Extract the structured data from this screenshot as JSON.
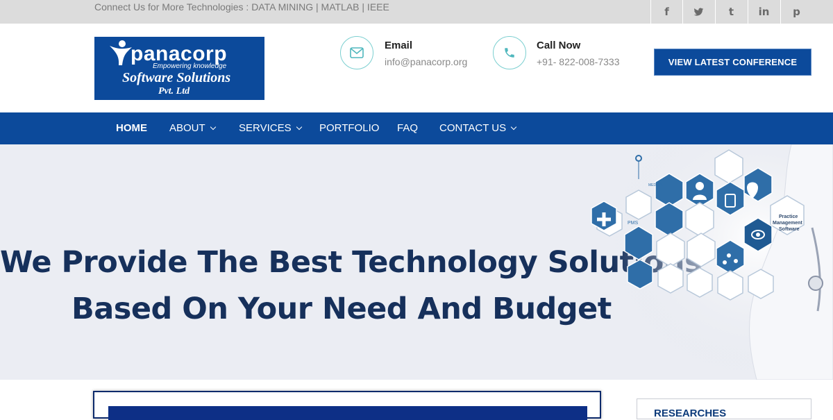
{
  "topbar": {
    "tagline": "Connect Us for More Technologies : DATA MINING | MATLAB | IEEE",
    "social": [
      {
        "icon": "facebook-icon",
        "glyph": "f"
      },
      {
        "icon": "twitter-icon",
        "glyph": "t"
      },
      {
        "icon": "tumblr-icon",
        "glyph": "t"
      },
      {
        "icon": "linkedin-icon",
        "glyph": "in"
      },
      {
        "icon": "pinterest-icon",
        "glyph": "p"
      }
    ]
  },
  "logo": {
    "brand": "panacorp",
    "slogan": "Empowering knowledge",
    "line2": "Software Solutions",
    "line3": "Pvt. Ltd"
  },
  "contact": {
    "email_title": "Email",
    "email_value": "info@panacorp.org",
    "phone_title": "Call Now",
    "phone_value": "+91- 822-008-7333"
  },
  "header": {
    "conference_button": "VIEW LATEST CONFERENCE"
  },
  "nav": {
    "home": "HOME",
    "about": "ABOUT",
    "services": "SERVICES",
    "portfolio": "PORTFOLIO",
    "faq": "FAQ",
    "contact": "CONTACT US"
  },
  "hero": {
    "line1": "We Provide The Best Technology Solutions",
    "line2": "Based On Your Need And Budget",
    "art_labels": {
      "pms": "PMS",
      "practice1": "Practice",
      "practice2": "Management",
      "practice3": "Software",
      "medical": "MEDICAL"
    }
  },
  "sidebar": {
    "researches_title": "RESEARCHES"
  },
  "colors": {
    "brand_blue": "#0c4a9b",
    "hero_text": "#16305b",
    "accent_teal": "#4fb7bd"
  }
}
